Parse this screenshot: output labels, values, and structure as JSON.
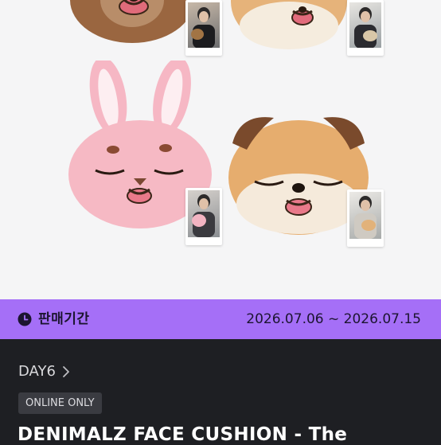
{
  "product": {
    "image_alt": "Denimalz face cushion product image",
    "sale_period_label": "판매기간",
    "sale_period_dates": "2026.07.06 ~ 2026.07.15",
    "artist": "DAY6",
    "badge": "ONLINE ONLY",
    "title": "DENIMALZ FACE CUSHION - The"
  },
  "colors": {
    "sale_bar": "#a56ff7",
    "page_bg": "#1e1f23",
    "hero_bg": "#f5f5f6"
  },
  "icons": [
    "clock-icon",
    "chevron-right-icon"
  ]
}
